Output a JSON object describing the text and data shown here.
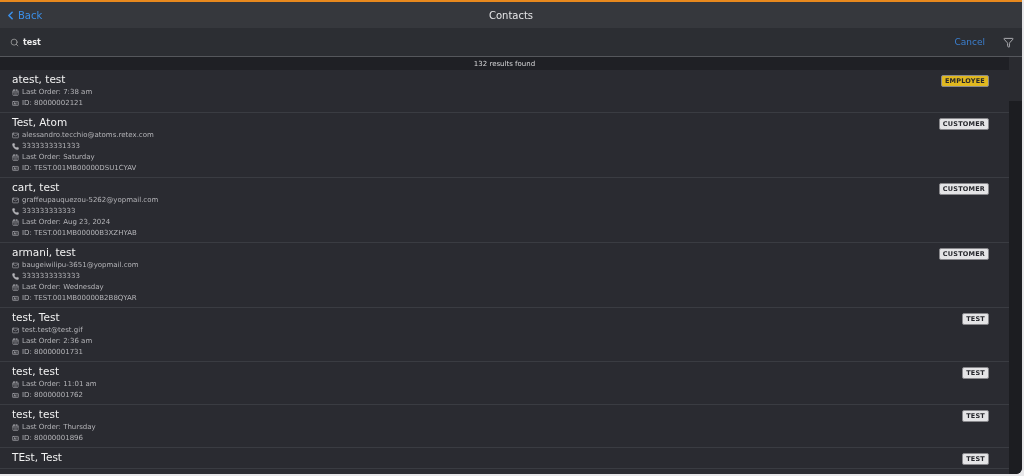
{
  "header": {
    "back": "Back",
    "title": "Contacts"
  },
  "search": {
    "value": "test",
    "cancel": "Cancel"
  },
  "results": "132 results found",
  "contacts": [
    {
      "name": "atest, test",
      "tag": "EMPLOYEE",
      "color": "#e0b820",
      "details": [
        {
          "kind": "order",
          "text": "Last Order: 7:38 am"
        },
        {
          "kind": "id",
          "text": "ID: 80000002121"
        }
      ]
    },
    {
      "name": "Test, Atom",
      "tag": "CUSTOMER",
      "color": "#e4e4e6",
      "details": [
        {
          "kind": "email",
          "text": "alessandro.tecchio@atoms.retex.com"
        },
        {
          "kind": "phone",
          "text": "3333333331333"
        },
        {
          "kind": "order",
          "text": "Last Order: Saturday"
        },
        {
          "kind": "id",
          "text": "ID: TEST.001MB00000DSU1CYAV"
        }
      ]
    },
    {
      "name": "cart, test",
      "tag": "CUSTOMER",
      "color": "#e4e4e6",
      "details": [
        {
          "kind": "email",
          "text": "graffeupauquezou-5262@yopmail.com"
        },
        {
          "kind": "phone",
          "text": "333333333333"
        },
        {
          "kind": "order",
          "text": "Last Order: Aug 23, 2024"
        },
        {
          "kind": "id",
          "text": "ID: TEST.001MB00000B3XZHYAB"
        }
      ]
    },
    {
      "name": "armani, test",
      "tag": "CUSTOMER",
      "color": "#e4e4e6",
      "details": [
        {
          "kind": "email",
          "text": "baugeiwilipu-3651@yopmail.com"
        },
        {
          "kind": "phone",
          "text": "3333333333333"
        },
        {
          "kind": "order",
          "text": "Last Order: Wednesday"
        },
        {
          "kind": "id",
          "text": "ID: TEST.001MB00000B2B8QYAR"
        }
      ]
    },
    {
      "name": "test, Test",
      "tag": "TEST",
      "color": "#e4e4e6",
      "details": [
        {
          "kind": "email",
          "text": "test.test@test.gif"
        },
        {
          "kind": "order",
          "text": "Last Order: 2:36 am"
        },
        {
          "kind": "id",
          "text": "ID: 80000001731"
        }
      ]
    },
    {
      "name": "test, test",
      "tag": "TEST",
      "color": "#e4e4e6",
      "details": [
        {
          "kind": "order",
          "text": "Last Order: 11:01 am"
        },
        {
          "kind": "id",
          "text": "ID: 80000001762"
        }
      ]
    },
    {
      "name": "test, test",
      "tag": "TEST",
      "color": "#e4e4e6",
      "details": [
        {
          "kind": "order",
          "text": "Last Order: Thursday"
        },
        {
          "kind": "id",
          "text": "ID: 80000001896"
        }
      ]
    },
    {
      "name": "TEst, Test",
      "tag": "TEST",
      "color": "#e4e4e6"
    }
  ]
}
